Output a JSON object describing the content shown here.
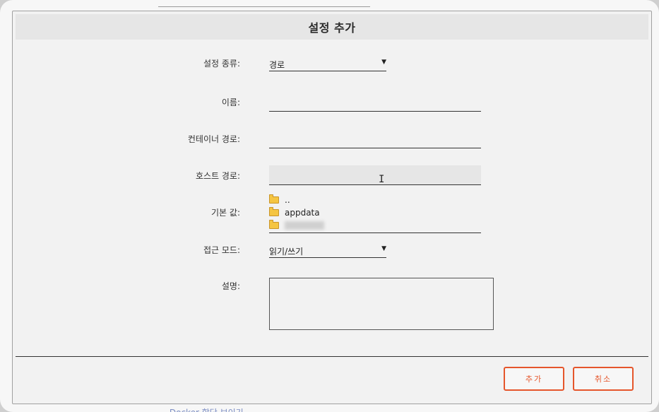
{
  "background": {
    "footer_link": "⌄ Docker 할당 보이기"
  },
  "dialog": {
    "title": "설정 추가",
    "fields": {
      "config_type": {
        "label": "설정 종류:",
        "value": "경로"
      },
      "name": {
        "label": "이름:",
        "value": ""
      },
      "container_path": {
        "label": "컨테이너 경로:",
        "value": ""
      },
      "host_path": {
        "label": "호스트 경로:",
        "value": ""
      },
      "default_value": {
        "label": "기본 값:",
        "tree": [
          {
            "name": "..",
            "icon": "folder-icon"
          },
          {
            "name": "appdata",
            "icon": "folder-icon"
          },
          {
            "name": "",
            "icon": "folder-icon",
            "blurred": true
          }
        ]
      },
      "access_mode": {
        "label": "접근 모드:",
        "value": "읽기/쓰기"
      },
      "description": {
        "label": "설명:",
        "value": ""
      }
    },
    "buttons": {
      "add": "추가",
      "cancel": "취소"
    }
  },
  "colors": {
    "accent": "#e5562b",
    "folder": "#f5c542"
  }
}
